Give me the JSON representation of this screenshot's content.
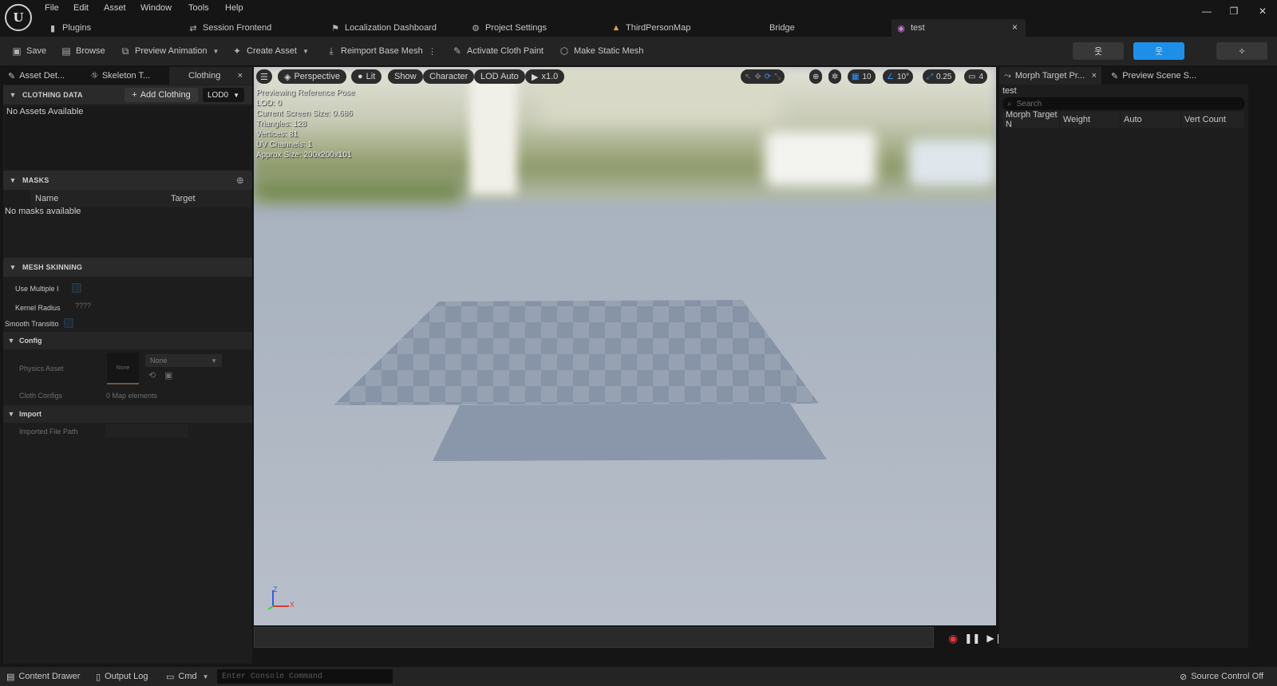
{
  "app": {
    "logo_text": "U"
  },
  "menu": [
    "File",
    "Edit",
    "Asset",
    "Window",
    "Tools",
    "Help"
  ],
  "window_controls": {
    "minimize": "—",
    "restore": "❐",
    "close": "✕"
  },
  "tabs": [
    {
      "label": "Plugins",
      "icon": "plug-icon"
    },
    {
      "label": "Session Frontend",
      "icon": "session-icon"
    },
    {
      "label": "Localization Dashboard",
      "icon": "flag-icon"
    },
    {
      "label": "Project Settings",
      "icon": "settings-icon"
    },
    {
      "label": "ThirdPersonMap",
      "icon": "level-icon"
    },
    {
      "label": "Bridge",
      "icon": ""
    },
    {
      "label": "test",
      "icon": "skeletal-mesh-icon",
      "close": "×"
    }
  ],
  "toolbar": {
    "save": "Save",
    "browse": "Browse",
    "preview_animation": "Preview Animation",
    "create_asset": "Create Asset",
    "reimport": "Reimport Base Mesh",
    "activate_cloth_paint": "Activate Cloth Paint",
    "make_static_mesh": "Make Static Mesh"
  },
  "left_panel": {
    "tabs": [
      "Asset Det...",
      "Skeleton T...",
      "Clothing"
    ],
    "close": "×",
    "clothing_data": {
      "title": "CLOTHING DATA",
      "add_button": "Add Clothing",
      "add_plus": "+",
      "lod": "LOD0",
      "empty": "No Assets Available"
    },
    "masks": {
      "title": "MASKS",
      "col_name": "Name",
      "col_target": "Target",
      "empty": "No masks available"
    },
    "mesh_skinning": {
      "title": "MESH SKINNING",
      "use_multiple": "Use Multiple I",
      "kernel_radius": "Kernel Radius",
      "kernel_value": "????",
      "smooth_transition": "Smooth Transitio"
    },
    "config": {
      "title": "Config",
      "physics_asset": "Physics Asset",
      "thumb_text": "None",
      "select_value": "None",
      "cloth_configs": "Cloth Configs",
      "cloth_configs_value": "0 Map elements"
    },
    "import": {
      "title": "Import",
      "imported_file_path": "Imported File Path"
    }
  },
  "viewport": {
    "perspective": "Perspective",
    "lit": "Lit",
    "show": "Show",
    "character": "Character",
    "lod": "LOD Auto",
    "speed": "x1.0",
    "grid": "10",
    "angle": "10°",
    "scale": "0.25",
    "camera": "4",
    "info": [
      "Previewing Reference Pose",
      "LOD: 0",
      "Current Screen Size: 0.686",
      "Triangles: 128",
      "Vertices: 81",
      "UV Channels: 1",
      "Approx Size: 200x200x101"
    ],
    "axis_z": "Z",
    "axis_x": "X"
  },
  "right_panel": {
    "tabs": [
      "Morph Target Pr...",
      "Preview Scene S..."
    ],
    "close": "×",
    "asset_name": "test",
    "search_placeholder": "Search",
    "columns": [
      "Morph Target N",
      "Weight",
      "Auto",
      "Vert Count"
    ]
  },
  "status_bar": {
    "content_drawer": "Content Drawer",
    "output_log": "Output Log",
    "cmd": "Cmd",
    "console_placeholder": "Enter Console Command",
    "source_control": "Source Control Off"
  }
}
